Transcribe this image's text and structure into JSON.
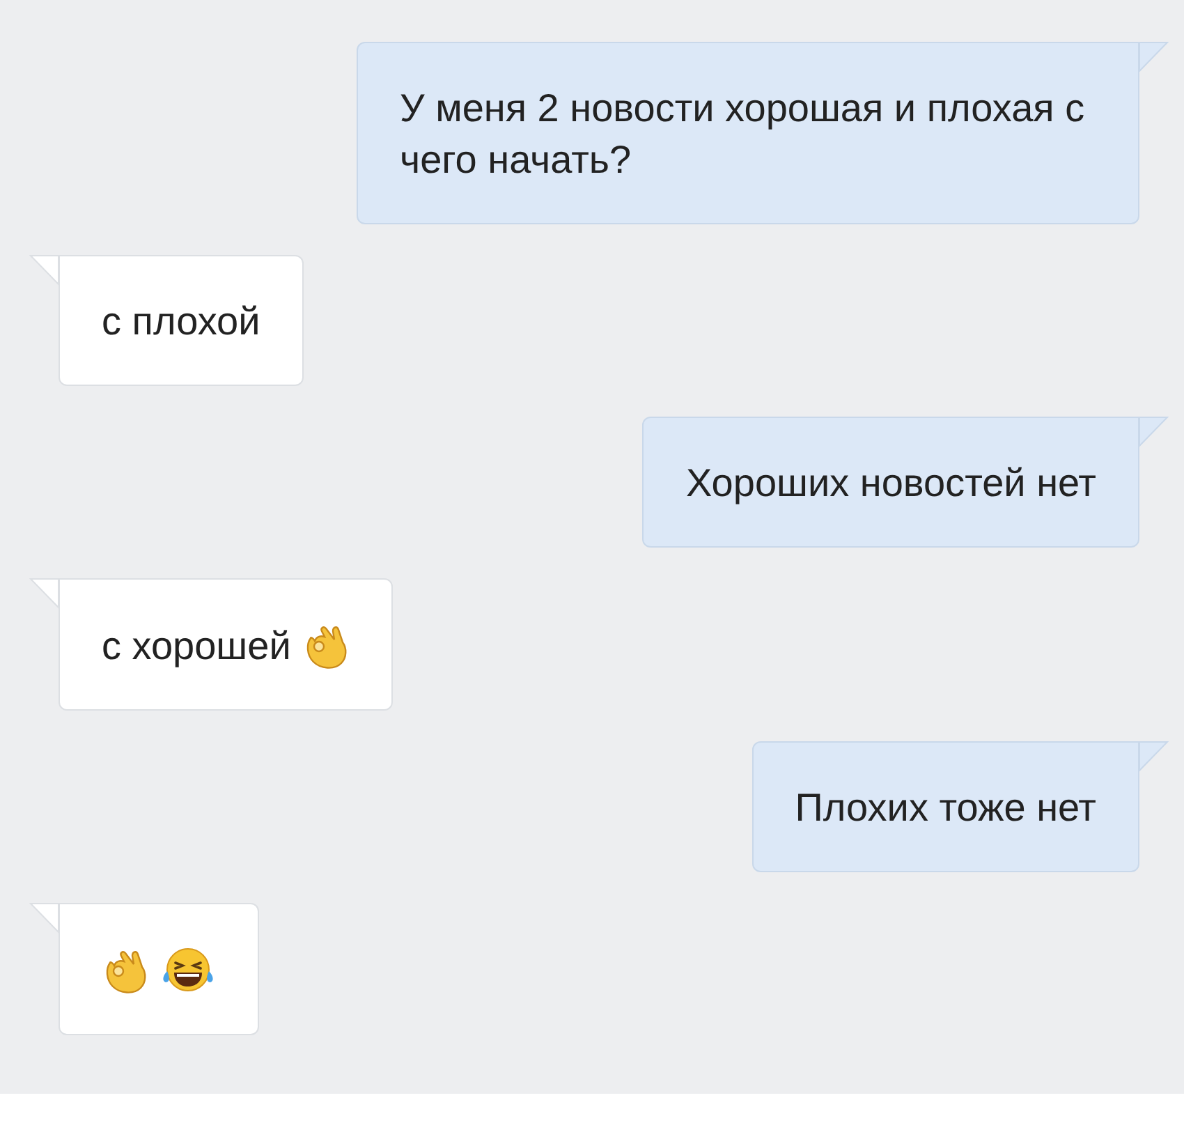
{
  "messages": [
    {
      "kind": "outgoing",
      "parts": [
        {
          "kind": "text",
          "text": "У меня 2 новости хорошая и плохая с чего начать?"
        }
      ]
    },
    {
      "kind": "incoming",
      "parts": [
        {
          "kind": "text",
          "text": "с плохой"
        }
      ]
    },
    {
      "kind": "outgoing",
      "parts": [
        {
          "kind": "text",
          "text": "Хороших новостей нет"
        }
      ]
    },
    {
      "kind": "incoming",
      "parts": [
        {
          "kind": "text",
          "text": "с хорошей"
        },
        {
          "kind": "ok-hand"
        }
      ]
    },
    {
      "kind": "outgoing",
      "parts": [
        {
          "kind": "text",
          "text": "Плохих тоже нет"
        }
      ]
    },
    {
      "kind": "incoming",
      "parts": [
        {
          "kind": "ok-hand"
        },
        {
          "kind": "laughing"
        }
      ]
    }
  ]
}
